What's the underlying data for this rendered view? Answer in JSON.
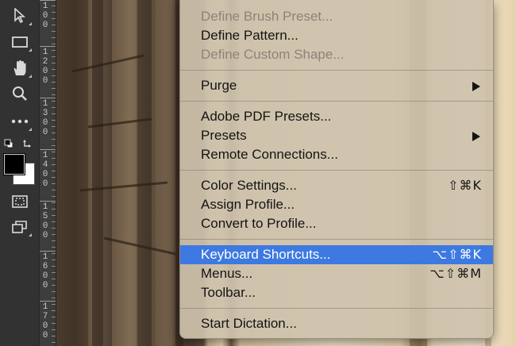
{
  "toolbar": {
    "tools": [
      {
        "name": "move-tool"
      },
      {
        "name": "rectangular-marquee-tool"
      },
      {
        "name": "hand-tool"
      },
      {
        "name": "zoom-tool"
      },
      {
        "name": "more-tools"
      }
    ],
    "foreground_color": "#000000",
    "background_color": "#ffffff"
  },
  "ruler": {
    "labels": [
      "100",
      "1200",
      "1300",
      "1400",
      "1500",
      "1600",
      "1700"
    ]
  },
  "menu": {
    "items": [
      {
        "label": "Define Brush Preset...",
        "enabled": false,
        "shortcut": "",
        "submenu": false
      },
      {
        "label": "Define Pattern...",
        "enabled": true,
        "shortcut": "",
        "submenu": false
      },
      {
        "label": "Define Custom Shape...",
        "enabled": false,
        "shortcut": "",
        "submenu": false
      },
      {
        "label": "Purge",
        "enabled": true,
        "shortcut": "",
        "submenu": true
      },
      {
        "label": "Adobe PDF Presets...",
        "enabled": true,
        "shortcut": "",
        "submenu": false
      },
      {
        "label": "Presets",
        "enabled": true,
        "shortcut": "",
        "submenu": true
      },
      {
        "label": "Remote Connections...",
        "enabled": true,
        "shortcut": "",
        "submenu": false
      },
      {
        "label": "Color Settings...",
        "enabled": true,
        "shortcut": "⇧⌘K",
        "submenu": false
      },
      {
        "label": "Assign Profile...",
        "enabled": true,
        "shortcut": "",
        "submenu": false
      },
      {
        "label": "Convert to Profile...",
        "enabled": true,
        "shortcut": "",
        "submenu": false
      },
      {
        "label": "Keyboard Shortcuts...",
        "enabled": true,
        "shortcut": "⌥⇧⌘K",
        "submenu": false,
        "selected": true
      },
      {
        "label": "Menus...",
        "enabled": true,
        "shortcut": "⌥⇧⌘M",
        "submenu": false
      },
      {
        "label": "Toolbar...",
        "enabled": true,
        "shortcut": "",
        "submenu": false
      },
      {
        "label": "Start Dictation...",
        "enabled": true,
        "shortcut": "",
        "submenu": false
      }
    ],
    "highlight_color": "#3d79e0"
  }
}
